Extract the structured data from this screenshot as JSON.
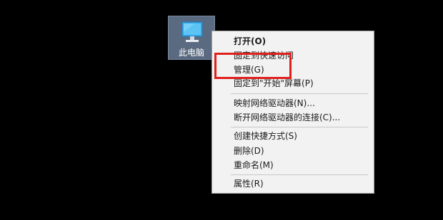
{
  "desktop": {
    "icon": {
      "label": "此电脑",
      "icon_name": "computer-monitor-icon"
    }
  },
  "context_menu": {
    "groups": [
      [
        {
          "label": "打开(O)",
          "bold": true
        },
        {
          "label": "固定到快速访问"
        },
        {
          "label": "管理(G)"
        },
        {
          "label": "固定到\"开始\"屏幕(P)"
        }
      ],
      [
        {
          "label": "映射网络驱动器(N)..."
        },
        {
          "label": "断开网络驱动器的连接(C)..."
        }
      ],
      [
        {
          "label": "创建快捷方式(S)"
        },
        {
          "label": "删除(D)"
        },
        {
          "label": "重命名(M)"
        }
      ],
      [
        {
          "label": "属性(R)"
        }
      ]
    ]
  },
  "highlight": {
    "target": "管理(G)",
    "color": "#e0201c"
  }
}
